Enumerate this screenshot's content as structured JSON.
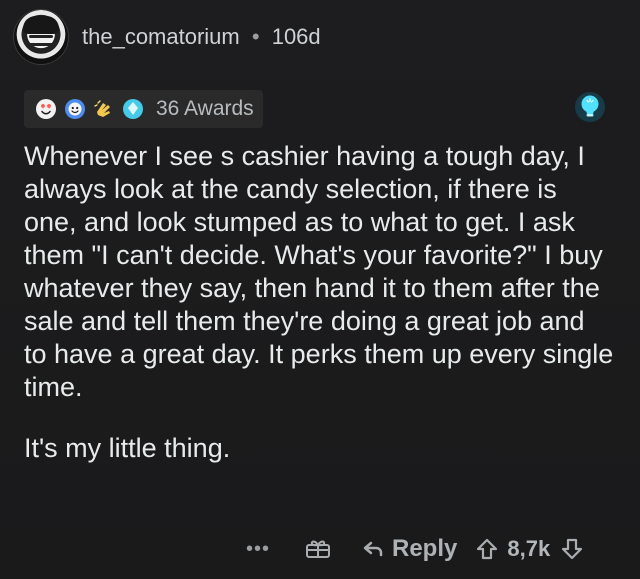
{
  "comment": {
    "username": "the_comatorium",
    "separator": "•",
    "age": "106d",
    "awards_count_label": "36 Awards",
    "body_lines": [
      "Whenever I see s cashier having a tough day, I always look at the candy selection, if there is one, and look stumped as to what to get. I ask them \"I can't decide. What's your favorite?\" I buy whatever they say, then hand it to them after the sale and tell them they're doing a great job and to have a great day. It perks them up every single time.",
      "It's my little thing."
    ],
    "actions": {
      "more_label": "•••",
      "reply_label": "Reply",
      "score": "8,7k"
    },
    "icons": {
      "avatar": "avatar",
      "award_1": "heart-eyes-icon",
      "award_2": "wholesome-icon",
      "award_3": "gold-clap-icon",
      "award_4": "diamond-icon",
      "bulb": "lightbulb-icon",
      "gift": "gift-icon",
      "reply": "reply-icon",
      "upvote": "upvote-icon",
      "downvote": "downvote-icon"
    },
    "colors": {
      "background": "#1a1a1b",
      "text": "#e8ebec",
      "muted": "#a9adb0",
      "awards_chip": "#2a2a2b",
      "bulb_glow": "#52e0ff"
    }
  }
}
